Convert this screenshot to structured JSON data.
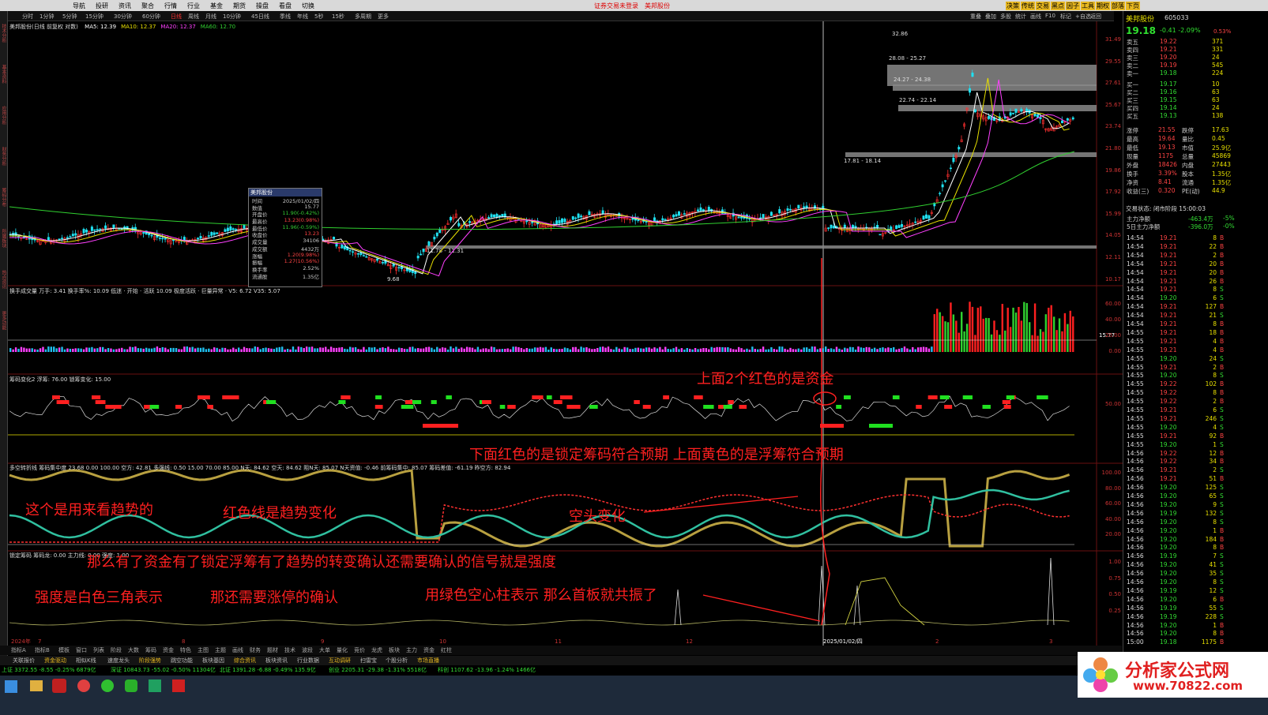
{
  "window": {
    "title": "证券交易未登录　美邦股份"
  },
  "menu": [
    "导航",
    "投研",
    "资讯",
    "聚合",
    "行情",
    "行业",
    "基金",
    "期货",
    "操盘",
    "看盘",
    "切换"
  ],
  "menu_right": [
    "决策",
    "传统",
    "交易",
    "黑点",
    "因子",
    "工具",
    "期权",
    "部落",
    "下页"
  ],
  "periods": [
    "分时",
    "1分钟",
    "5分钟",
    "15分钟",
    "30分钟",
    "60分钟",
    "日线",
    "周线",
    "月线",
    "10分钟",
    "45日线",
    "季线",
    "年线",
    "5秒",
    "15秒",
    "多周期",
    "更多"
  ],
  "toolbar_right": [
    "重叠",
    "叠加",
    "多股",
    "统计",
    "画线",
    "F10",
    "标记",
    "+自选",
    "返回"
  ],
  "left_strip": [
    "技术分析",
    "基本资料",
    "应用分析",
    "财务分析",
    "筹码分布",
    "所属板块",
    "热点资讯",
    "更多功能"
  ],
  "main_chart": {
    "header": "美邦股份(日线 前复权 对数)",
    "ma": [
      {
        "label": "MA5: 12.39",
        "color": "#ffffff"
      },
      {
        "label": "MA10: 12.37",
        "color": "#e8e000"
      },
      {
        "label": "MA20: 12.37",
        "color": "#ff40ff"
      },
      {
        "label": "MA60: 12.70",
        "color": "#30d030"
      }
    ],
    "y_labels": [
      "31.49",
      "29.55",
      "27.61",
      "25.67",
      "23.74",
      "21.80",
      "19.86",
      "17.92",
      "15.99",
      "14.05",
      "12.11",
      "10.17"
    ],
    "price_high": "32.86",
    "low_label": "9.68",
    "zones": [
      "28.08 - 25.27",
      "24.27 - 24.38",
      "22.74 - 22.14",
      "17.81 - 18.14",
      "11.78 - 11.31"
    ]
  },
  "info_box": {
    "title": "美邦股份",
    "rows": [
      [
        "时间",
        "2025/01/02/四"
      ],
      [
        "数值",
        "15.77"
      ],
      [
        "开盘价",
        "11.90(-0.42%)"
      ],
      [
        "最高价",
        "13.23(0.98%)"
      ],
      [
        "最低价",
        "11.96(-0.59%)"
      ],
      [
        "收盘价",
        "13.23"
      ],
      [
        "成交量",
        "34106"
      ],
      [
        "成交额",
        "4432万"
      ],
      [
        "涨幅",
        "1.20(9.98%)"
      ],
      [
        "振幅",
        "1.27(10.56%)"
      ],
      [
        "换手率",
        "2.52%"
      ],
      [
        "流通股",
        "1.35亿"
      ]
    ]
  },
  "vol_panel": {
    "header": "换手成交量 万手: 3.41  换手率%: 10.09  低迷 · 开始 · 活跃 10.09  极度活跃 · 巨量异常 · V5: 6.72 V35: 5.07",
    "y_labels": [
      "60.00",
      "40.00",
      "20.00",
      "0.00"
    ],
    "marker": "15.77"
  },
  "chip_panel": {
    "header": "筹码变化2 浮筹: 76.00  锁筹变化: 15.00",
    "y_labels": [
      "50.00"
    ]
  },
  "trend_panel": {
    "header": "多空转折线 筹码集中度 23.68  0.00  100.00  空方: 42.81  多强线: 0.50  15.00  70.00  85.00  N天: 84.62  空天: 84.62  阻N天: 85.07  N天资值: -0.46  前筹码集中: 85.07  筹码差值: -61.19  昨空方: 82.94",
    "y_labels": [
      "100.00",
      "80.00",
      "60.00",
      "40.00",
      "20.00"
    ]
  },
  "lock_panel": {
    "header": "锁定筹码  筹码龙: 0.00  主力线: 0.00  强度: 1.00",
    "y_labels": [
      "1.00",
      "0.75",
      "0.50",
      "0.25"
    ]
  },
  "x_axis": [
    "2024年",
    "7",
    "8",
    "9",
    "10",
    "11",
    "12",
    "2025/01/02/四",
    "2",
    "3"
  ],
  "annotations": {
    "capital": "上面2个红色的是资金",
    "lock": "下面红色的是锁定筹码符合预期 上面黄色的是浮筹符合预期",
    "trend": "这个是用来看趋势的",
    "redline": "红色线是趋势变化",
    "bear": "空头变化",
    "signal": "那么有了资金有了锁定浮筹有了趋势的转变确认还需要确认的信号就是强度",
    "strength": "强度是白色三角表示",
    "limitup": "那还需要涨停的确认",
    "resonance": "用绿色空心柱表示 那么首板就共振了"
  },
  "quote": {
    "name": "美邦股份",
    "code": "605033",
    "price": "19.18",
    "change": "-0.41",
    "pct": "-2.09%",
    "tag": "0.53%",
    "asks": [
      [
        "卖五",
        "19.22",
        "371"
      ],
      [
        "卖四",
        "19.21",
        "331"
      ],
      [
        "卖三",
        "19.20",
        "24"
      ],
      [
        "卖二",
        "19.19",
        "545"
      ],
      [
        "卖一",
        "19.18",
        "224"
      ]
    ],
    "bids": [
      [
        "买一",
        "19.17",
        "10"
      ],
      [
        "买二",
        "19.16",
        "63"
      ],
      [
        "买三",
        "19.15",
        "63"
      ],
      [
        "买四",
        "19.14",
        "24"
      ],
      [
        "买五",
        "19.13",
        "138"
      ]
    ],
    "stats": [
      [
        "涨停",
        "21.55",
        "跌停",
        "17.63"
      ],
      [
        "最高",
        "19.64",
        "量比",
        "0.45"
      ],
      [
        "最低",
        "19.13",
        "市值",
        "25.9亿"
      ],
      [
        "现量",
        "1175",
        "总量",
        "45869"
      ],
      [
        "外盘",
        "18426",
        "内盘",
        "27443"
      ],
      [
        "换手",
        "3.39%",
        "股本",
        "1.35亿"
      ],
      [
        "净资",
        "8.41",
        "流通",
        "1.35亿"
      ],
      [
        "收益(三)",
        "0.320",
        "PE(动)",
        "44.9"
      ]
    ],
    "status": "交易状态: 闭市阶段 15:00:03",
    "flows": [
      [
        "主力净额",
        "-463.4万",
        "-5%"
      ],
      [
        "5日主力净额",
        "-396.0万",
        "-0%"
      ]
    ]
  },
  "ticks": [
    [
      "14:54",
      "19.21",
      "8",
      "B"
    ],
    [
      "14:54",
      "19.21",
      "22",
      "B"
    ],
    [
      "14:54",
      "19.21",
      "2",
      "B"
    ],
    [
      "14:54",
      "19.21",
      "20",
      "B"
    ],
    [
      "14:54",
      "19.21",
      "20",
      "B"
    ],
    [
      "14:54",
      "19.21",
      "26",
      "B"
    ],
    [
      "14:54",
      "19.21",
      "8",
      "S"
    ],
    [
      "14:54",
      "19.20",
      "6",
      "S"
    ],
    [
      "14:54",
      "19.21",
      "127",
      "B"
    ],
    [
      "14:54",
      "19.21",
      "21",
      "S"
    ],
    [
      "14:54",
      "19.21",
      "8",
      "B"
    ],
    [
      "14:55",
      "19.21",
      "18",
      "B"
    ],
    [
      "14:55",
      "19.21",
      "4",
      "B"
    ],
    [
      "14:55",
      "19.21",
      "4",
      "B"
    ],
    [
      "14:55",
      "19.20",
      "24",
      "S"
    ],
    [
      "14:55",
      "19.21",
      "2",
      "B"
    ],
    [
      "14:55",
      "19.20",
      "8",
      "S"
    ],
    [
      "14:55",
      "19.22",
      "102",
      "B"
    ],
    [
      "14:55",
      "19.22",
      "8",
      "B"
    ],
    [
      "14:55",
      "19.22",
      "2",
      "B"
    ],
    [
      "14:55",
      "19.21",
      "6",
      "S"
    ],
    [
      "14:55",
      "19.21",
      "246",
      "S"
    ],
    [
      "14:55",
      "19.20",
      "4",
      "S"
    ],
    [
      "14:55",
      "19.21",
      "92",
      "B"
    ],
    [
      "14:55",
      "19.20",
      "1",
      "S"
    ],
    [
      "14:56",
      "19.22",
      "12",
      "B"
    ],
    [
      "14:56",
      "19.22",
      "34",
      "B"
    ],
    [
      "14:56",
      "19.21",
      "2",
      "S"
    ],
    [
      "14:56",
      "19.21",
      "51",
      "B"
    ],
    [
      "14:56",
      "19.20",
      "125",
      "S"
    ],
    [
      "14:56",
      "19.20",
      "65",
      "S"
    ],
    [
      "14:56",
      "19.20",
      "9",
      "S"
    ],
    [
      "14:56",
      "19.19",
      "132",
      "S"
    ],
    [
      "14:56",
      "19.20",
      "8",
      "S"
    ],
    [
      "14:56",
      "19.20",
      "1",
      "B"
    ],
    [
      "14:56",
      "19.20",
      "184",
      "B"
    ],
    [
      "14:56",
      "19.20",
      "8",
      "B"
    ],
    [
      "14:56",
      "19.19",
      "7",
      "S"
    ],
    [
      "14:56",
      "19.20",
      "41",
      "S"
    ],
    [
      "14:56",
      "19.20",
      "35",
      "S"
    ],
    [
      "14:56",
      "19.20",
      "8",
      "S"
    ],
    [
      "14:56",
      "19.19",
      "12",
      "S"
    ],
    [
      "14:56",
      "19.20",
      "6",
      "B"
    ],
    [
      "14:56",
      "19.19",
      "55",
      "S"
    ],
    [
      "14:56",
      "19.19",
      "228",
      "S"
    ],
    [
      "14:56",
      "19.20",
      "1",
      "B"
    ],
    [
      "14:56",
      "19.20",
      "8",
      "B"
    ],
    [
      "15:00",
      "19.18",
      "1175",
      "B"
    ]
  ],
  "bottom_tabs": [
    "指标A",
    "指标B",
    "模板",
    "窗口",
    "列表",
    "阶段",
    "大数",
    "筹码",
    "资金",
    "特色",
    "主图",
    "主题",
    "画线",
    "财务",
    "题材",
    "技术",
    "波段",
    "大单",
    "量化",
    "竞价",
    "龙虎",
    "板块",
    "主力",
    "资金",
    "红柱"
  ],
  "tab_row2": [
    "关联报价",
    "资金驱动",
    "相似K线",
    "速度龙头",
    "阶段强势",
    "跳空功能",
    "板块基因",
    "综合资讯",
    "板块资讯",
    "行业数据",
    "互动调研",
    "扫雷宝",
    "个股分析",
    "市场直播"
  ],
  "index_bar": [
    [
      "上证",
      "3372.55",
      "-8.55",
      "-0.25%",
      "6879亿"
    ],
    [
      "深证",
      "10843.73",
      "-55.02",
      "-0.50%",
      "11304亿"
    ],
    [
      "北证",
      "1391.28",
      "-6.88",
      "-0.49%",
      "135.9亿"
    ],
    [
      "创业",
      "2205.31",
      "-29.38",
      "-1.31%",
      "5518亿"
    ],
    [
      "科创",
      "1107.62",
      "-13.96",
      "-1.24%",
      "1466亿"
    ]
  ],
  "logo": {
    "title": "分析家公式网",
    "url": "www.70822.com"
  }
}
